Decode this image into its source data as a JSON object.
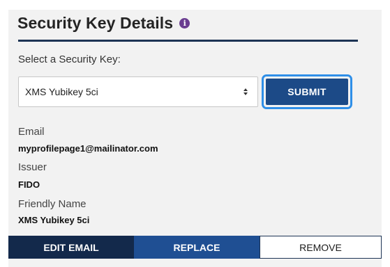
{
  "header": {
    "title": "Security Key Details",
    "info_icon_glyph": "i",
    "accent_color": "#1c3354"
  },
  "form": {
    "select_label": "Select a Security Key:",
    "selected_key": "XMS Yubikey 5ci",
    "submit_label": "SUBMIT"
  },
  "details": {
    "email_label": "Email",
    "email_value": "myprofilepage1@mailinator.com",
    "issuer_label": "Issuer",
    "issuer_value": "FIDO",
    "friendly_name_label": "Friendly Name",
    "friendly_name_value": "XMS Yubikey 5ci"
  },
  "actions": {
    "edit_email_label": "EDIT EMAIL",
    "replace_label": "REPLACE",
    "remove_label": "REMOVE"
  }
}
